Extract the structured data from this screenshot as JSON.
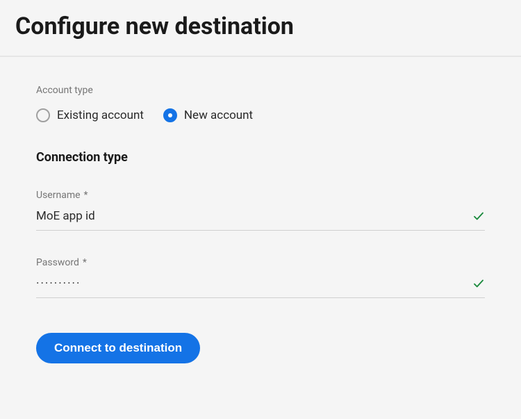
{
  "header": {
    "title": "Configure new destination"
  },
  "account": {
    "section_label": "Account type",
    "options": {
      "existing": "Existing account",
      "new": "New account"
    },
    "selected": "new"
  },
  "connection": {
    "heading": "Connection type",
    "username": {
      "label": "Username",
      "required_marker": "*",
      "value": "MoE app id",
      "valid": true
    },
    "password": {
      "label": "Password",
      "required_marker": "*",
      "value_masked": "··········",
      "valid": true
    }
  },
  "actions": {
    "connect_label": "Connect to destination"
  }
}
